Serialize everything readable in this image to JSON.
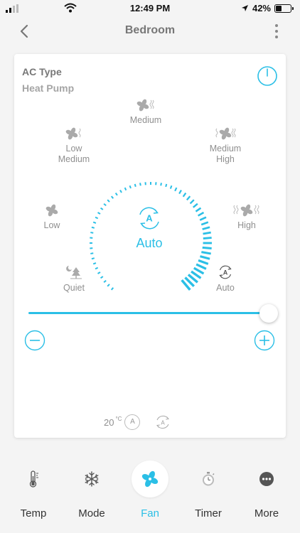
{
  "status_bar": {
    "time": "12:49 PM",
    "battery": "42%",
    "battery_level": 0.42
  },
  "header": {
    "title": "Bedroom"
  },
  "card": {
    "ac_type_label": "AC Type",
    "ac_type_value": "Heat Pump",
    "fan_options": [
      {
        "id": "medium",
        "label": "Medium"
      },
      {
        "id": "low-medium",
        "label": "Low\nMedium"
      },
      {
        "id": "medium-high",
        "label": "Medium\nHigh"
      },
      {
        "id": "low",
        "label": "Low"
      },
      {
        "id": "high",
        "label": "High"
      },
      {
        "id": "quiet",
        "label": "Quiet"
      },
      {
        "id": "auto",
        "label": "Auto"
      }
    ],
    "current_mode": "Auto",
    "slider_value": 1.0,
    "temperature": "20",
    "temperature_unit": "°C",
    "badge_a": "A"
  },
  "tabs": [
    {
      "label": "Temp",
      "icon": "thermometer-icon",
      "active": false
    },
    {
      "label": "Mode",
      "icon": "snowflake-icon",
      "active": false
    },
    {
      "label": "Fan",
      "icon": "fan-icon",
      "active": true
    },
    {
      "label": "Timer",
      "icon": "timer-icon",
      "active": false
    },
    {
      "label": "More",
      "icon": "more-icon",
      "active": false
    }
  ],
  "colors": {
    "accent": "#2bbfe6",
    "muted": "#8f8f8f",
    "background": "#f4f4f4"
  }
}
